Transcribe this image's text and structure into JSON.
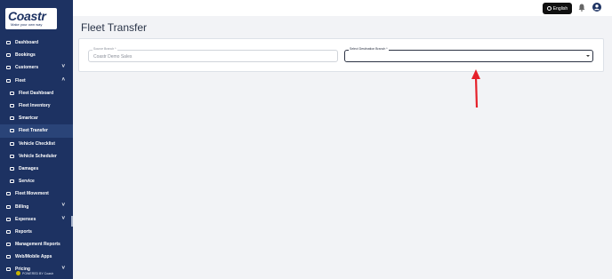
{
  "brand": {
    "name": "Coastr",
    "tagline": "Make your own way",
    "powered_by": "POWERED BY Coastr"
  },
  "sidebar": {
    "items": [
      {
        "label": "Dashboard",
        "icon": "dashboard-icon"
      },
      {
        "label": "Bookings",
        "icon": "bookings-icon"
      },
      {
        "label": "Customers",
        "icon": "customers-icon",
        "expandable": true
      },
      {
        "label": "Fleet",
        "icon": "fleet-icon",
        "expandable": true,
        "expanded": true
      },
      {
        "label": "Fleet Dashboard",
        "icon": "fleet-dashboard-icon",
        "sub": true
      },
      {
        "label": "Fleet Inventory",
        "icon": "car-icon",
        "sub": true
      },
      {
        "label": "Smartcar",
        "icon": "smartcar-icon",
        "sub": true
      },
      {
        "label": "Fleet Transfer",
        "icon": "transfer-icon",
        "sub": true,
        "active": true
      },
      {
        "label": "Vehicle Checklist",
        "icon": "checklist-icon",
        "sub": true
      },
      {
        "label": "Vehicle Scheduler",
        "icon": "scheduler-icon",
        "sub": true
      },
      {
        "label": "Damages",
        "icon": "warning-icon",
        "sub": true
      },
      {
        "label": "Service",
        "icon": "wrench-icon",
        "sub": true
      },
      {
        "label": "Fleet Movement",
        "icon": "movement-icon"
      },
      {
        "label": "Billing",
        "icon": "billing-icon",
        "expandable": true
      },
      {
        "label": "Expenses",
        "icon": "expenses-icon",
        "expandable": true
      },
      {
        "label": "Reports",
        "icon": "reports-icon"
      },
      {
        "label": "Management Reports",
        "icon": "management-reports-icon"
      },
      {
        "label": "Web/Mobile Apps",
        "icon": "apps-icon"
      },
      {
        "label": "Pricing",
        "icon": "pricing-icon",
        "expandable": true
      }
    ]
  },
  "topbar": {
    "language_label": "English"
  },
  "page": {
    "title": "Fleet Transfer",
    "source_branch": {
      "label": "Source Branch *",
      "value": "Coastr Demo Sales"
    },
    "destination_branch": {
      "label": "Select Destination Branch *",
      "value": ""
    }
  },
  "colors": {
    "sidebar": "#1d3262",
    "accent_arrow": "#e5202a"
  }
}
